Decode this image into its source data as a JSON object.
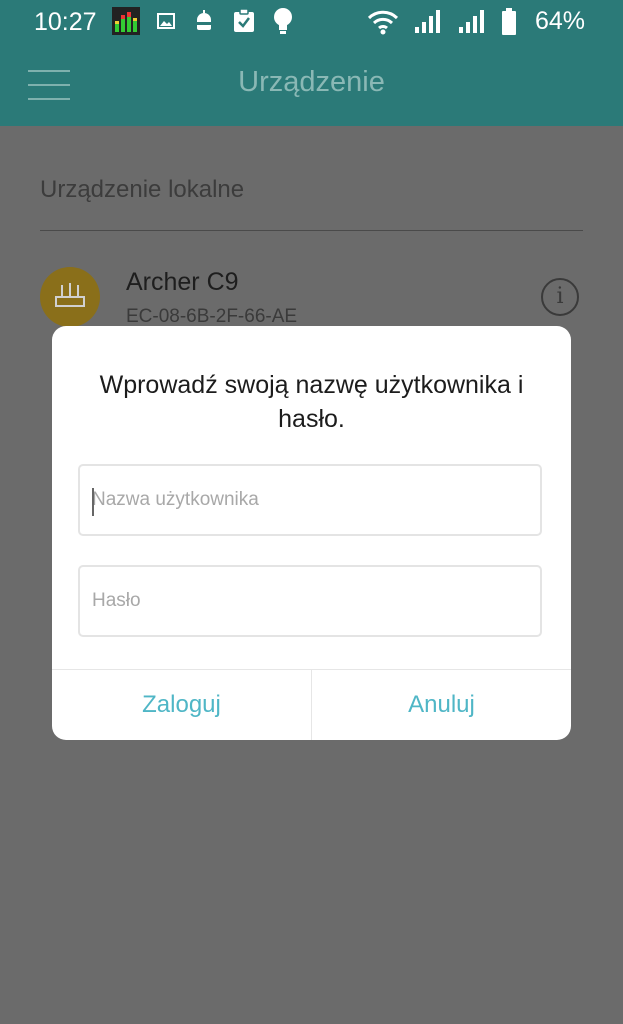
{
  "status_bar": {
    "time": "10:27",
    "battery": "64%",
    "left_icons": [
      "equalizer-app-icon",
      "image-notification-icon",
      "android-notification-icon",
      "clipboard-check-icon",
      "lightbulb-icon"
    ],
    "right_icons": [
      "wifi-icon",
      "signal-icon",
      "signal-icon",
      "battery-icon"
    ]
  },
  "app_bar": {
    "title": "Urządzenie",
    "color": "#2b7a78"
  },
  "content": {
    "section_header": "Urządzenie lokalne",
    "device": {
      "name": "Archer C9",
      "mac": "EC-08-6B-2F-66-AE",
      "avatar_color": "#e8b923",
      "info_symbol": "i"
    }
  },
  "dialog": {
    "title": "Wprowadź swoją nazwę użytkownika i hasło.",
    "username": {
      "placeholder": "Nazwa użytkownika",
      "value": ""
    },
    "password": {
      "placeholder": "Hasło",
      "value": ""
    },
    "login_label": "Zaloguj",
    "cancel_label": "Anuluj",
    "accent_color": "#4fb6c6"
  }
}
